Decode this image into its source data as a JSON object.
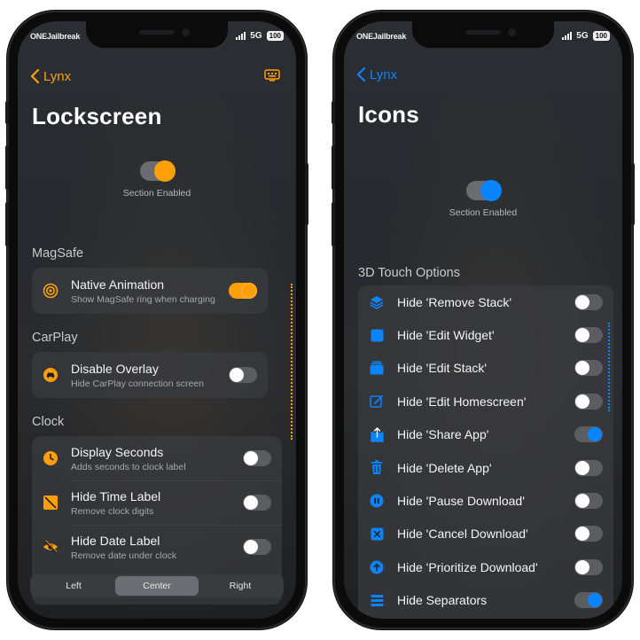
{
  "status": {
    "carrier": "ONEJailbreak",
    "network": "5G",
    "battery": "100"
  },
  "colors": {
    "orange": "#ff9f0a",
    "blue": "#0a84ff",
    "white": "#ffffff"
  },
  "left": {
    "back_label": "Lynx",
    "title": "Lockscreen",
    "section_caption": "Section Enabled",
    "section_enabled": true,
    "groups": {
      "magsafe": {
        "header": "MagSafe",
        "items": [
          {
            "title": "Native Animation",
            "subtitle": "Show MagSafe ring when charging",
            "icon": "magsafe-ring-icon",
            "on": true
          }
        ]
      },
      "carplay": {
        "header": "CarPlay",
        "items": [
          {
            "title": "Disable Overlay",
            "subtitle": "Hide CarPlay connection screen",
            "icon": "car-icon",
            "on": false
          }
        ]
      },
      "clock": {
        "header": "Clock",
        "items": [
          {
            "title": "Display Seconds",
            "subtitle": "Adds seconds to clock label",
            "icon": "clock-icon",
            "on": false
          },
          {
            "title": "Hide Time Label",
            "subtitle": "Remove clock digits",
            "icon": "hide-time-icon",
            "on": false
          },
          {
            "title": "Hide Date Label",
            "subtitle": "Remove date under clock",
            "icon": "eye-slash-icon",
            "on": false
          }
        ]
      }
    },
    "alignment": {
      "options": [
        "Left",
        "Center",
        "Right"
      ],
      "selected": "Center"
    }
  },
  "right": {
    "back_label": "Lynx",
    "title": "Icons",
    "section_caption": "Section Enabled",
    "section_enabled": true,
    "group_header": "3D Touch Options",
    "items": [
      {
        "title": "Hide 'Remove Stack'",
        "icon": "stack-layers-icon",
        "on": false
      },
      {
        "title": "Hide 'Edit Widget'",
        "icon": "square-icon",
        "on": false
      },
      {
        "title": "Hide 'Edit Stack'",
        "icon": "stacked-squares-icon",
        "on": false
      },
      {
        "title": "Hide 'Edit Homescreen'",
        "icon": "edit-square-icon",
        "on": false
      },
      {
        "title": "Hide 'Share App'",
        "icon": "share-icon",
        "on": true
      },
      {
        "title": "Hide 'Delete App'",
        "icon": "trash-icon",
        "on": false
      },
      {
        "title": "Hide 'Pause Download'",
        "icon": "pause-circle-icon",
        "on": false
      },
      {
        "title": "Hide 'Cancel Download'",
        "icon": "xmark-square-icon",
        "on": false
      },
      {
        "title": "Hide 'Prioritize Download'",
        "icon": "arrow-up-circle-icon",
        "on": false
      },
      {
        "title": "Hide Separators",
        "icon": "separators-icon",
        "on": true
      }
    ]
  }
}
